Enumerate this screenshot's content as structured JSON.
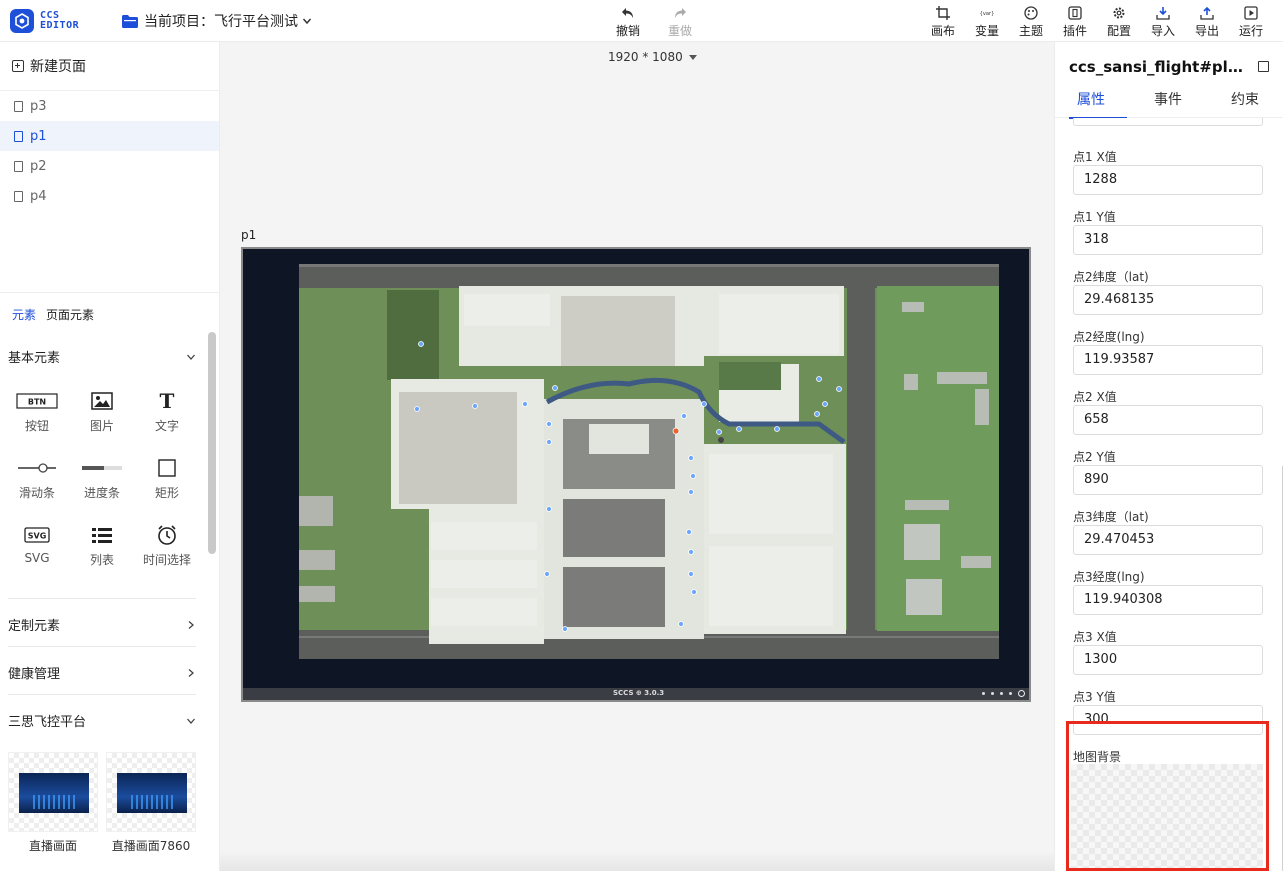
{
  "header": {
    "logo_line1": "CCS",
    "logo_line2": "EDITOR",
    "project_label": "当前项目：飞行平台测试",
    "undo_label": "撤销",
    "redo_label": "重做",
    "tools": [
      {
        "label": "画布",
        "icon": "canvas-crop-icon"
      },
      {
        "label": "变量",
        "icon": "var-icon"
      },
      {
        "label": "主题",
        "icon": "palette-icon"
      },
      {
        "label": "插件",
        "icon": "plugin-icon"
      },
      {
        "label": "配置",
        "icon": "gear-icon"
      },
      {
        "label": "导入",
        "icon": "import-icon"
      },
      {
        "label": "导出",
        "icon": "export-icon"
      },
      {
        "label": "运行",
        "icon": "play-icon"
      }
    ]
  },
  "left": {
    "new_page": "新建页面",
    "pages": [
      {
        "name": "p3",
        "active": false
      },
      {
        "name": "p1",
        "active": true
      },
      {
        "name": "p2",
        "active": false
      },
      {
        "name": "p4",
        "active": false
      }
    ],
    "tabs": [
      "元素",
      "页面元素"
    ],
    "basic_section": "基本元素",
    "elements": [
      {
        "label": "按钮",
        "icon": "button-icon"
      },
      {
        "label": "图片",
        "icon": "image-icon"
      },
      {
        "label": "文字",
        "icon": "text-icon"
      },
      {
        "label": "滑动条",
        "icon": "slider-icon"
      },
      {
        "label": "进度条",
        "icon": "progress-icon"
      },
      {
        "label": "矩形",
        "icon": "rect-icon"
      },
      {
        "label": "SVG",
        "icon": "svg-icon"
      },
      {
        "label": "列表",
        "icon": "list-icon"
      },
      {
        "label": "时间选择",
        "icon": "clock-icon"
      }
    ],
    "custom_section": "定制元素",
    "health_section": "健康管理",
    "flight_section": "三思飞控平台",
    "thumbs": [
      "直播画面",
      "直播画面7860"
    ]
  },
  "canvas": {
    "resolution": "1920 * 1080",
    "page_label": "p1",
    "footer_text": "SCCS ⊕ 3.0.3"
  },
  "right": {
    "component_title": "ccs_sansi_flight#plugin-...",
    "tabs": [
      "属性",
      "事件",
      "约束"
    ],
    "props": [
      {
        "label": "点1 X值",
        "value": "1288"
      },
      {
        "label": "点1 Y值",
        "value": "318"
      },
      {
        "label": "点2纬度（lat)",
        "value": "29.468135"
      },
      {
        "label": "点2经度(lng)",
        "value": "119.93587"
      },
      {
        "label": "点2 X值",
        "value": "658"
      },
      {
        "label": "点2 Y值",
        "value": "890"
      },
      {
        "label": "点3纬度（lat)",
        "value": "29.470453"
      },
      {
        "label": "点3经度(lng)",
        "value": "119.940308"
      },
      {
        "label": "点3 X值",
        "value": "1300"
      },
      {
        "label": "点3 Y值",
        "value": "300"
      }
    ],
    "map_bg_label": "地图背景"
  },
  "colors": {
    "accent": "#1e4fd8",
    "highlight": "#e8291c",
    "map_green": "#6e8f58"
  }
}
